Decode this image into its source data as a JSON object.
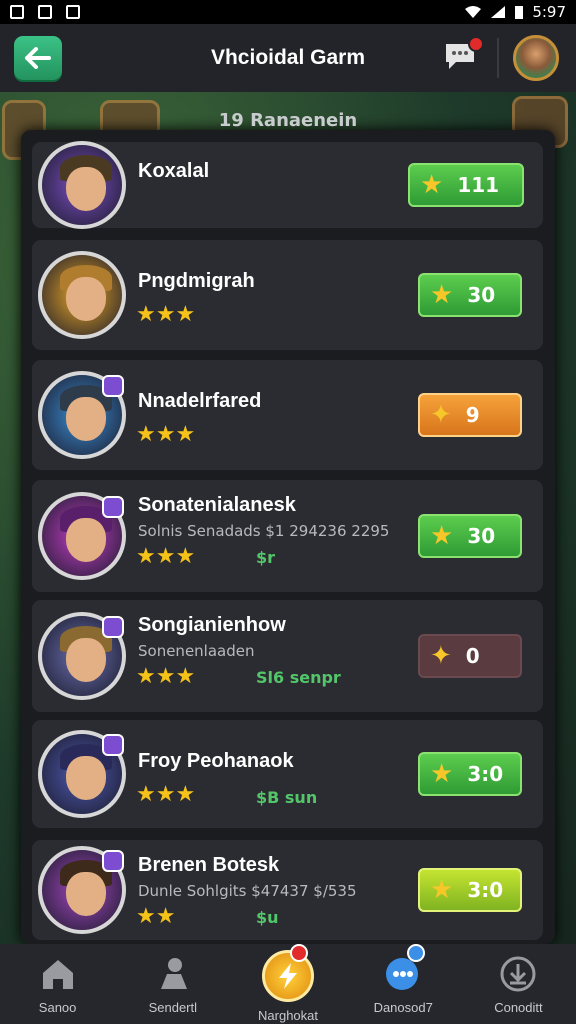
{
  "status": {
    "time": "5:97"
  },
  "header": {
    "title": "Vhcioidal Garm",
    "back_icon": "arrow-left-icon",
    "chat_icon": "chat-bubble-icon",
    "chat_badge": "1"
  },
  "panel": {
    "subtitle": "19 Ranaenein"
  },
  "rows": [
    {
      "name": "Koxalal",
      "sub": "",
      "cash": "",
      "score": "111",
      "style": "green",
      "stars": "",
      "icon": "star-icon"
    },
    {
      "name": "Pngdmigrah",
      "sub": "",
      "cash": "",
      "score": "30",
      "style": "green",
      "stars": "★★★",
      "icon": "star-icon"
    },
    {
      "name": "Nnadelrfared",
      "sub": "",
      "cash": "",
      "score": "9",
      "style": "orange",
      "stars": "★★★",
      "icon": "sword-icon"
    },
    {
      "name": "Sonatenialanesk",
      "sub": "Solnis Senadads $1 294236 2295",
      "cash": "$r",
      "score": "30",
      "style": "green",
      "stars": "★★★",
      "icon": "star-icon"
    },
    {
      "name": "Songianienhow",
      "sub": "Sonenenlaaden",
      "cash": "Sl6 senpr",
      "score": "0",
      "style": "dim",
      "stars": "★★★",
      "icon": "sword-icon"
    },
    {
      "name": "Froy Peohanaok",
      "sub": "",
      "cash": "$B sun",
      "score": "3:0",
      "style": "green",
      "stars": "★★★",
      "icon": "star-icon"
    },
    {
      "name": "Brenen Botesk",
      "sub": "Dunle Sohlgits $47437 $/535",
      "cash": "$u",
      "score": "3:0",
      "style": "lime",
      "stars": "★★",
      "icon": "star-icon"
    }
  ],
  "nav": [
    {
      "label": "Sanoo",
      "icon": "home-icon"
    },
    {
      "label": "Sendertl",
      "icon": "player-icon"
    },
    {
      "label": "Narghokat",
      "icon": "lightning-icon",
      "badge": "1"
    },
    {
      "label": "Danosod7",
      "icon": "chat-icon",
      "badge": "1"
    },
    {
      "label": "Conoditt",
      "icon": "download-icon"
    }
  ]
}
